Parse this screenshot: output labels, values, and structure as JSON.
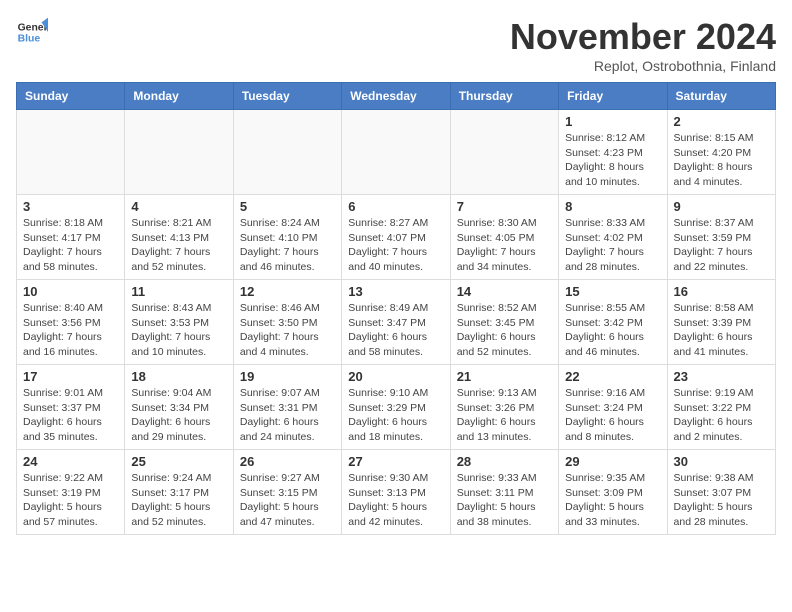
{
  "logo": {
    "line1": "General",
    "line2": "Blue"
  },
  "title": "November 2024",
  "subtitle": "Replot, Ostrobothnia, Finland",
  "header_days": [
    "Sunday",
    "Monday",
    "Tuesday",
    "Wednesday",
    "Thursday",
    "Friday",
    "Saturday"
  ],
  "weeks": [
    [
      {
        "day": "",
        "info": ""
      },
      {
        "day": "",
        "info": ""
      },
      {
        "day": "",
        "info": ""
      },
      {
        "day": "",
        "info": ""
      },
      {
        "day": "",
        "info": ""
      },
      {
        "day": "1",
        "info": "Sunrise: 8:12 AM\nSunset: 4:23 PM\nDaylight: 8 hours\nand 10 minutes."
      },
      {
        "day": "2",
        "info": "Sunrise: 8:15 AM\nSunset: 4:20 PM\nDaylight: 8 hours\nand 4 minutes."
      }
    ],
    [
      {
        "day": "3",
        "info": "Sunrise: 8:18 AM\nSunset: 4:17 PM\nDaylight: 7 hours\nand 58 minutes."
      },
      {
        "day": "4",
        "info": "Sunrise: 8:21 AM\nSunset: 4:13 PM\nDaylight: 7 hours\nand 52 minutes."
      },
      {
        "day": "5",
        "info": "Sunrise: 8:24 AM\nSunset: 4:10 PM\nDaylight: 7 hours\nand 46 minutes."
      },
      {
        "day": "6",
        "info": "Sunrise: 8:27 AM\nSunset: 4:07 PM\nDaylight: 7 hours\nand 40 minutes."
      },
      {
        "day": "7",
        "info": "Sunrise: 8:30 AM\nSunset: 4:05 PM\nDaylight: 7 hours\nand 34 minutes."
      },
      {
        "day": "8",
        "info": "Sunrise: 8:33 AM\nSunset: 4:02 PM\nDaylight: 7 hours\nand 28 minutes."
      },
      {
        "day": "9",
        "info": "Sunrise: 8:37 AM\nSunset: 3:59 PM\nDaylight: 7 hours\nand 22 minutes."
      }
    ],
    [
      {
        "day": "10",
        "info": "Sunrise: 8:40 AM\nSunset: 3:56 PM\nDaylight: 7 hours\nand 16 minutes."
      },
      {
        "day": "11",
        "info": "Sunrise: 8:43 AM\nSunset: 3:53 PM\nDaylight: 7 hours\nand 10 minutes."
      },
      {
        "day": "12",
        "info": "Sunrise: 8:46 AM\nSunset: 3:50 PM\nDaylight: 7 hours\nand 4 minutes."
      },
      {
        "day": "13",
        "info": "Sunrise: 8:49 AM\nSunset: 3:47 PM\nDaylight: 6 hours\nand 58 minutes."
      },
      {
        "day": "14",
        "info": "Sunrise: 8:52 AM\nSunset: 3:45 PM\nDaylight: 6 hours\nand 52 minutes."
      },
      {
        "day": "15",
        "info": "Sunrise: 8:55 AM\nSunset: 3:42 PM\nDaylight: 6 hours\nand 46 minutes."
      },
      {
        "day": "16",
        "info": "Sunrise: 8:58 AM\nSunset: 3:39 PM\nDaylight: 6 hours\nand 41 minutes."
      }
    ],
    [
      {
        "day": "17",
        "info": "Sunrise: 9:01 AM\nSunset: 3:37 PM\nDaylight: 6 hours\nand 35 minutes."
      },
      {
        "day": "18",
        "info": "Sunrise: 9:04 AM\nSunset: 3:34 PM\nDaylight: 6 hours\nand 29 minutes."
      },
      {
        "day": "19",
        "info": "Sunrise: 9:07 AM\nSunset: 3:31 PM\nDaylight: 6 hours\nand 24 minutes."
      },
      {
        "day": "20",
        "info": "Sunrise: 9:10 AM\nSunset: 3:29 PM\nDaylight: 6 hours\nand 18 minutes."
      },
      {
        "day": "21",
        "info": "Sunrise: 9:13 AM\nSunset: 3:26 PM\nDaylight: 6 hours\nand 13 minutes."
      },
      {
        "day": "22",
        "info": "Sunrise: 9:16 AM\nSunset: 3:24 PM\nDaylight: 6 hours\nand 8 minutes."
      },
      {
        "day": "23",
        "info": "Sunrise: 9:19 AM\nSunset: 3:22 PM\nDaylight: 6 hours\nand 2 minutes."
      }
    ],
    [
      {
        "day": "24",
        "info": "Sunrise: 9:22 AM\nSunset: 3:19 PM\nDaylight: 5 hours\nand 57 minutes."
      },
      {
        "day": "25",
        "info": "Sunrise: 9:24 AM\nSunset: 3:17 PM\nDaylight: 5 hours\nand 52 minutes."
      },
      {
        "day": "26",
        "info": "Sunrise: 9:27 AM\nSunset: 3:15 PM\nDaylight: 5 hours\nand 47 minutes."
      },
      {
        "day": "27",
        "info": "Sunrise: 9:30 AM\nSunset: 3:13 PM\nDaylight: 5 hours\nand 42 minutes."
      },
      {
        "day": "28",
        "info": "Sunrise: 9:33 AM\nSunset: 3:11 PM\nDaylight: 5 hours\nand 38 minutes."
      },
      {
        "day": "29",
        "info": "Sunrise: 9:35 AM\nSunset: 3:09 PM\nDaylight: 5 hours\nand 33 minutes."
      },
      {
        "day": "30",
        "info": "Sunrise: 9:38 AM\nSunset: 3:07 PM\nDaylight: 5 hours\nand 28 minutes."
      }
    ]
  ]
}
